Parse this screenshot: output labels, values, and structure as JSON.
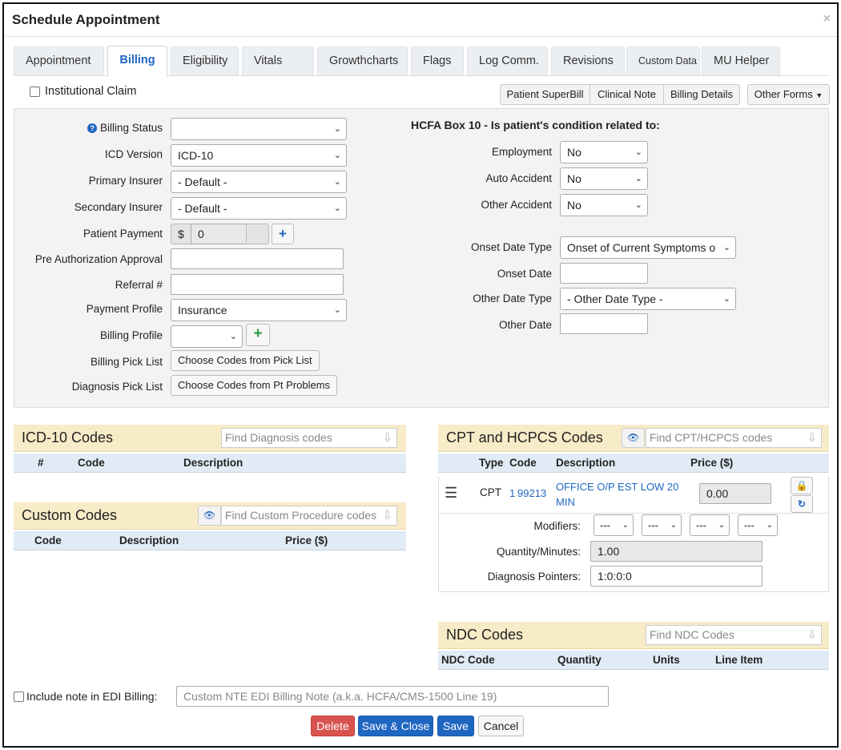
{
  "dialog": {
    "title": "Schedule Appointment",
    "close": "×"
  },
  "tabs": [
    {
      "label": "Appointment"
    },
    {
      "label": "Billing"
    },
    {
      "label": "Eligibility"
    },
    {
      "label": "Vitals"
    },
    {
      "label": "Growthcharts"
    },
    {
      "label": "Flags"
    },
    {
      "label": "Log Comm."
    },
    {
      "label": "Revisions"
    },
    {
      "label": "Custom Data"
    },
    {
      "label": "MU Helper"
    }
  ],
  "active_tab": "Billing",
  "institutional_claim": {
    "label": "Institutional Claim",
    "checked": false
  },
  "forms_buttons": {
    "superbill": "Patient SuperBill",
    "clinical_note": "Clinical Note",
    "billing_details": "Billing Details",
    "other_forms": "Other Forms"
  },
  "billing": {
    "billing_status": {
      "label": "Billing Status",
      "value": ""
    },
    "icd_version": {
      "label": "ICD Version",
      "value": "ICD-10"
    },
    "primary_insurer": {
      "label": "Primary Insurer",
      "value": "- Default -"
    },
    "secondary_insurer": {
      "label": "Secondary Insurer",
      "value": "- Default -"
    },
    "patient_payment": {
      "label": "Patient Payment",
      "currency": "$",
      "value": "0"
    },
    "pre_auth": {
      "label": "Pre Authorization Approval",
      "value": ""
    },
    "referral": {
      "label": "Referral #",
      "value": ""
    },
    "payment_profile": {
      "label": "Payment Profile",
      "value": "Insurance"
    },
    "billing_profile": {
      "label": "Billing Profile",
      "value": ""
    },
    "billing_pick_list": {
      "label": "Billing Pick List",
      "button": "Choose Codes from Pick List"
    },
    "diagnosis_pick_list": {
      "label": "Diagnosis Pick List",
      "button": "Choose Codes from Pt Problems"
    }
  },
  "hcfa": {
    "heading": "HCFA Box 10 - Is patient's condition related to:",
    "employment": {
      "label": "Employment",
      "value": "No"
    },
    "auto_accident": {
      "label": "Auto Accident",
      "value": "No"
    },
    "other_accident": {
      "label": "Other Accident",
      "value": "No"
    },
    "onset_date_type": {
      "label": "Onset Date Type",
      "value": "Onset of Current Symptoms o"
    },
    "onset_date": {
      "label": "Onset Date",
      "value": ""
    },
    "other_date_type": {
      "label": "Other Date Type",
      "value": "- Other Date Type -"
    },
    "other_date": {
      "label": "Other Date",
      "value": ""
    }
  },
  "icd_codes": {
    "title": "ICD-10 Codes",
    "search_placeholder": "Find Diagnosis codes",
    "columns": [
      "#",
      "Code",
      "Description"
    ]
  },
  "custom_codes": {
    "title": "Custom Codes",
    "search_placeholder": "Find Custom Procedure codes",
    "columns": [
      "Code",
      "Description",
      "Price ($)"
    ]
  },
  "cpt_codes": {
    "title": "CPT and HCPCS Codes",
    "search_placeholder": "Find CPT/HCPCS codes",
    "columns": [
      "Type",
      "Code",
      "Description",
      "Price ($)"
    ],
    "rows": [
      {
        "type": "CPT",
        "index": "1",
        "code": "99213",
        "description_line1": "OFFICE O/P EST LOW 20",
        "description_line2": "MIN",
        "price": "0.00"
      }
    ],
    "modifiers_label": "Modifiers:",
    "modifiers": [
      "---",
      "---",
      "---",
      "---"
    ],
    "quantity_label": "Quantity/Minutes:",
    "quantity": "1.00",
    "diagnosis_pointers_label": "Diagnosis Pointers:",
    "diagnosis_pointers": "1:0:0:0"
  },
  "ndc_codes": {
    "title": "NDC Codes",
    "search_placeholder": "Find NDC Codes",
    "columns": [
      "NDC Code",
      "Quantity",
      "Units",
      "Line Item"
    ]
  },
  "edi_note": {
    "label": "Include note in EDI Billing:",
    "placeholder": "Custom NTE EDI Billing Note (a.k.a. HCFA/CMS-1500 Line 19)"
  },
  "actions": {
    "delete": "Delete",
    "save_close": "Save & Close",
    "save": "Save",
    "cancel": "Cancel"
  },
  "colors": {
    "primary_blue": "#1f66c1",
    "danger_red": "#d9534f",
    "section_header": "#f8ebc8",
    "table_header": "#e1ebf5"
  }
}
